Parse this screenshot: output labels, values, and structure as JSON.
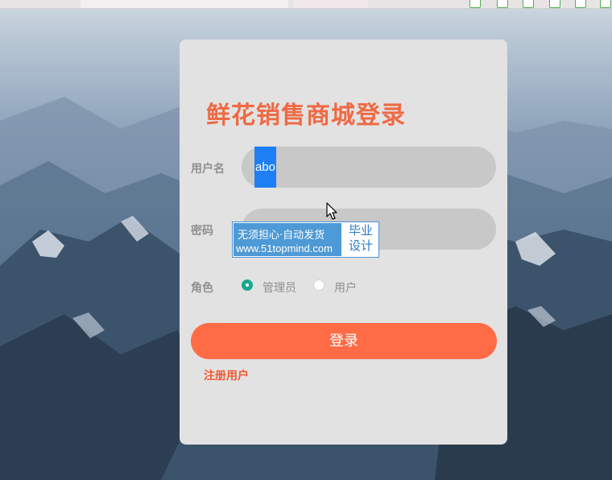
{
  "login": {
    "title": "鲜花销售商城登录",
    "username_label": "用户名",
    "username_value": "abo",
    "password_label": "密码",
    "role_label": "角色",
    "roles": [
      {
        "label": "管理员",
        "selected": true
      },
      {
        "label": "用户",
        "selected": false
      }
    ],
    "login_button": "登录",
    "register_link": "注册用户"
  },
  "watermark": {
    "line1": "无须担心·自动发货",
    "line2": "www.51topmind.com",
    "badge_line1": "毕业",
    "badge_line2": "设计"
  },
  "colors": {
    "accent": "#ff6b45",
    "title": "#ee6a44",
    "radio_selected": "#19a88c",
    "card": "#e3e2e2",
    "input": "#c9c8c8"
  },
  "icons": [
    "mouse-cursor-icon",
    "radio-selected-icon",
    "radio-unselected-icon"
  ]
}
